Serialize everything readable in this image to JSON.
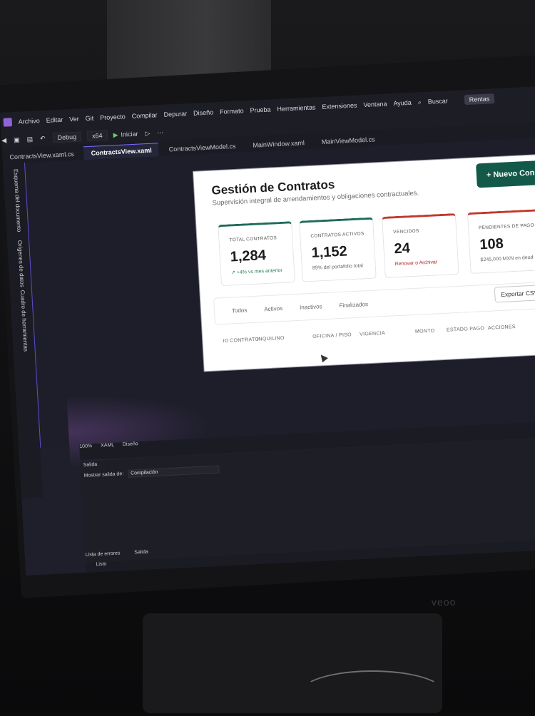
{
  "ide": {
    "menu": [
      "Archivo",
      "Editar",
      "Ver",
      "Git",
      "Proyecto",
      "Compilar",
      "Depurar",
      "Diseño",
      "Formato",
      "Prueba",
      "Herramientas",
      "Extensiones",
      "Ventana",
      "Ayuda"
    ],
    "search_label": "Buscar",
    "solution_badge": "Rentas",
    "toolbar": {
      "config": "Debug",
      "platform": "x64",
      "run_label": "Iniciar"
    },
    "tabs": [
      "ContractsView.xaml.cs",
      "ContractsView.xaml",
      "ContractsViewModel.cs",
      "MainWindow.xaml",
      "MainViewModel.cs"
    ],
    "side_panels": [
      "Esquema del documento",
      "Orígenes de datos",
      "Cuadro de herramientas"
    ],
    "zoom": "100%",
    "view_tabs": [
      "XAML",
      "Diseño"
    ],
    "output": {
      "title": "Salida",
      "show_label": "Mostrar salida de:",
      "selected": "Compilación"
    },
    "bottom_tabs": [
      "Lista de errores",
      "Salida"
    ],
    "status": "Listo"
  },
  "designer": {
    "title": "Gestión de Contratos",
    "subtitle": "Supervisión integral de arrendamientos y obligaciones contractuales.",
    "new_button": "+ Nuevo Con",
    "kpis": [
      {
        "label": "TOTAL CONTRATOS",
        "value": "1,284",
        "note": "↗ +4% vs mes anterior",
        "accent": "#1f6b5a"
      },
      {
        "label": "CONTRATOS ACTIVOS",
        "value": "1,152",
        "note": "89% del portafolio total",
        "accent": "#1f6b5a"
      },
      {
        "label": "VENCIDOS",
        "value": "24",
        "note": "Renovar o Archivar",
        "accent": "#c0392b"
      },
      {
        "label": "PENDIENTES DE PAGO",
        "value": "108",
        "note": "$245,000 MXN en deud",
        "accent": "#c0392b"
      }
    ],
    "filters": [
      "Todos",
      "Activos",
      "Inactivos",
      "Finalizados"
    ],
    "export_button": "Exportar CSV",
    "columns": [
      "ID CONTRATO",
      "INQUILINO",
      "OFICINA / PISO",
      "VIGENCIA",
      "MONTO",
      "ESTADO PAGO",
      "ACCIONES"
    ]
  },
  "monitor_brand": "veoo"
}
